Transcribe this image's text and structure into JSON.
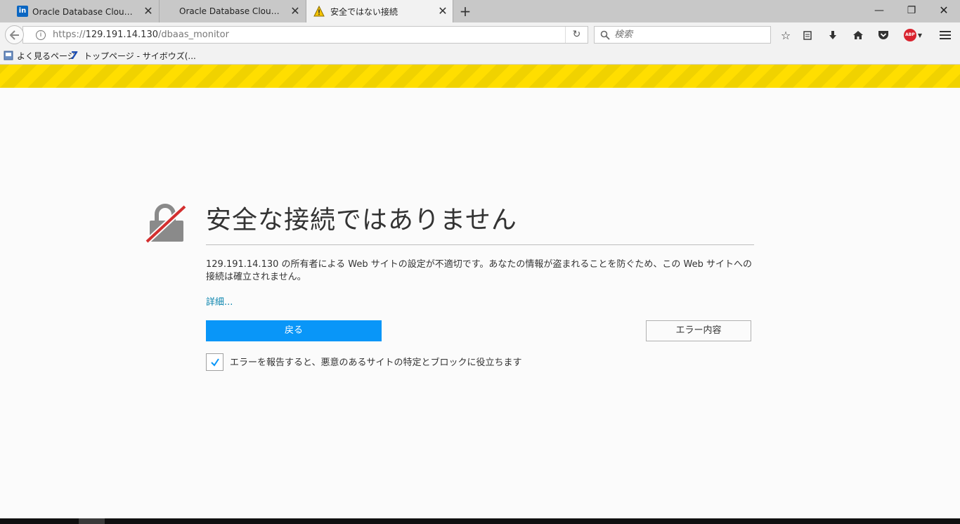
{
  "tabs": [
    {
      "title": "Oracle Database Cloudを使...",
      "icon": "linkedin-icon",
      "favicon_text": "in",
      "active": false
    },
    {
      "title": "Oracle Database Cloud Ser...",
      "icon": "none",
      "active": false
    },
    {
      "title": "安全ではない接続",
      "icon": "warning-icon",
      "active": true
    }
  ],
  "navbar": {
    "url_scheme": "https://",
    "url_host": "129.191.14.130",
    "url_path": "/dbaas_monitor",
    "search_placeholder": "検索"
  },
  "toolbar": {
    "abp_label": "ABP"
  },
  "bookmarks": [
    {
      "label": "よく見るページ",
      "icon": "bookmark-folder-icon"
    },
    {
      "label": "トップページ - サイボウズ(...",
      "icon": "cybozu-icon"
    }
  ],
  "error_page": {
    "title": "安全な接続ではありません",
    "description": "129.191.14.130 の所有者による Web サイトの設定が不適切です。あなたの情報が盗まれることを防ぐため、この Web サイトへの接続は確立されません。",
    "details_link": "詳細...",
    "back_button": "戻る",
    "error_details_button": "エラー内容",
    "report_label": "エラーを報告すると、悪意のあるサイトの特定とブロックに役立ちます",
    "report_checked": true
  },
  "colors": {
    "primary_button": "#0996f8",
    "warning_stripe": "#ffde00",
    "link": "#0a84ae"
  }
}
